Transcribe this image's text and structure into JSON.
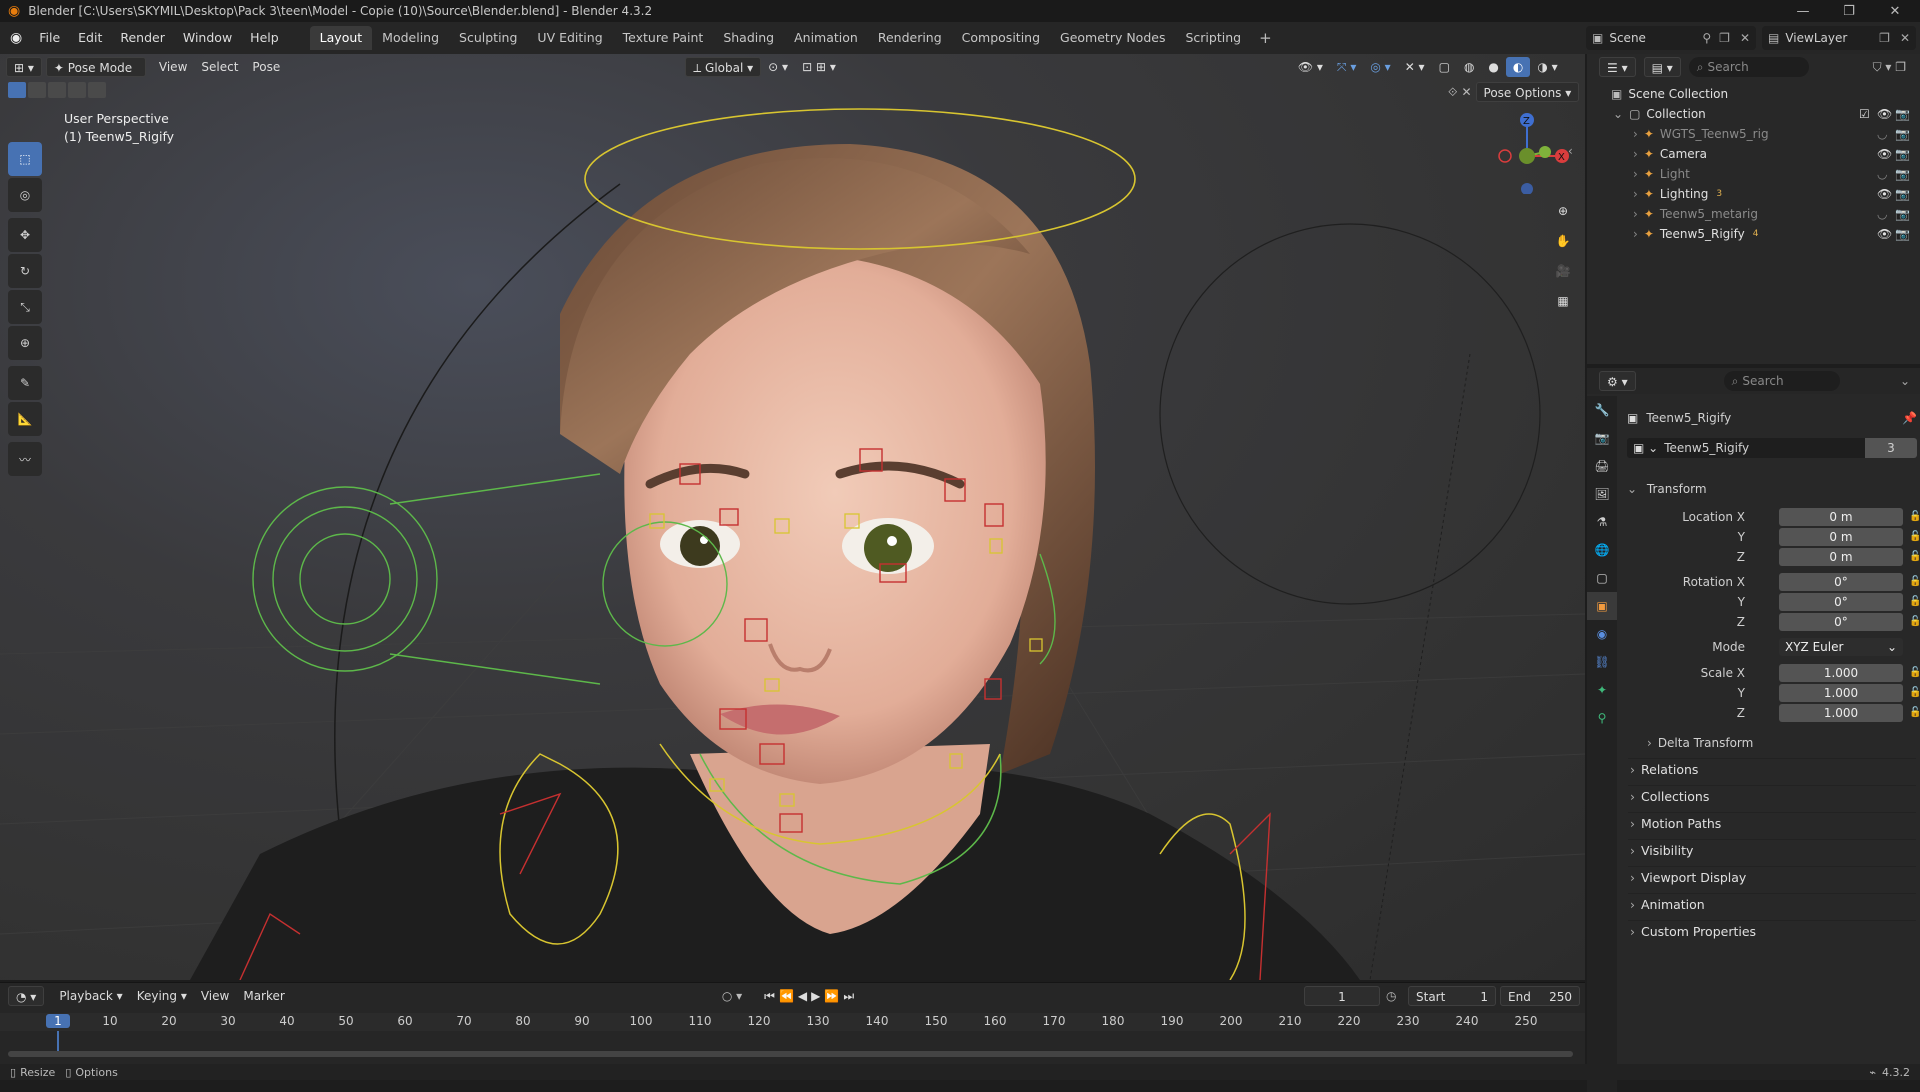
{
  "window": {
    "title": "Blender [C:\\Users\\SKYMIL\\Desktop\\Pack 3\\teen\\Model - Copie (10)\\Source\\Blender.blend] - Blender 4.3.2"
  },
  "menu": {
    "items": [
      "File",
      "Edit",
      "Render",
      "Window",
      "Help"
    ]
  },
  "workspaces": {
    "tabs": [
      "Layout",
      "Modeling",
      "Sculpting",
      "UV Editing",
      "Texture Paint",
      "Shading",
      "Animation",
      "Rendering",
      "Compositing",
      "Geometry Nodes",
      "Scripting"
    ],
    "active": "Layout"
  },
  "topright": {
    "scene": "Scene",
    "viewlayer": "ViewLayer"
  },
  "viewport": {
    "mode": "Pose Mode",
    "menus": [
      "View",
      "Select",
      "Pose"
    ],
    "orientation": "Global",
    "pose_options": "Pose Options",
    "info_line1": "User Perspective",
    "info_line2": "(1) Teenw5_Rigify",
    "gizmo": {
      "z": "Z",
      "x": "X"
    }
  },
  "outliner": {
    "search_placeholder": "Search",
    "scene_collection": "Scene Collection",
    "collection": "Collection",
    "items": [
      {
        "name": "WGTS_Teenw5_rig",
        "dim": true
      },
      {
        "name": "Camera",
        "dim": false
      },
      {
        "name": "Light",
        "dim": true
      },
      {
        "name": "Lighting",
        "dim": false,
        "badge": "3"
      },
      {
        "name": "Teenw5_metarig",
        "dim": true
      },
      {
        "name": "Teenw5_Rigify",
        "dim": false,
        "badge": "4"
      }
    ]
  },
  "properties": {
    "search_placeholder": "Search",
    "object_name": "Teenw5_Rigify",
    "datablock": "Teenw5_Rigify",
    "users": "3",
    "transform_label": "Transform",
    "location": {
      "label": "Location X",
      "x": "0 m",
      "y": "0 m",
      "z": "0 m"
    },
    "rotation": {
      "label": "Rotation X",
      "x": "0°",
      "y": "0°",
      "z": "0°"
    },
    "mode_label": "Mode",
    "mode_value": "XYZ Euler",
    "scale": {
      "label": "Scale X",
      "x": "1.000",
      "y": "1.000",
      "z": "1.000"
    },
    "axis_y": "Y",
    "axis_z": "Z",
    "delta": "Delta Transform",
    "sections": [
      "Relations",
      "Collections",
      "Motion Paths",
      "Visibility",
      "Viewport Display",
      "Animation",
      "Custom Properties"
    ]
  },
  "timeline": {
    "menus": [
      "Playback",
      "Keying",
      "View",
      "Marker"
    ],
    "current_frame": "1",
    "start_label": "Start",
    "start": "1",
    "end_label": "End",
    "end": "250",
    "ruler": [
      "1",
      "10",
      "20",
      "30",
      "40",
      "50",
      "60",
      "70",
      "80",
      "90",
      "100",
      "110",
      "120",
      "130",
      "140",
      "150",
      "160",
      "170",
      "180",
      "190",
      "200",
      "210",
      "220",
      "230",
      "240",
      "250"
    ]
  },
  "status": {
    "left1": "Resize",
    "left2": "Options",
    "version": "4.3.2"
  },
  "colors": {
    "accent": "#4772b3",
    "bone_green": "#5db84a",
    "bone_yellow": "#d8c530",
    "bone_red": "#c53030"
  }
}
